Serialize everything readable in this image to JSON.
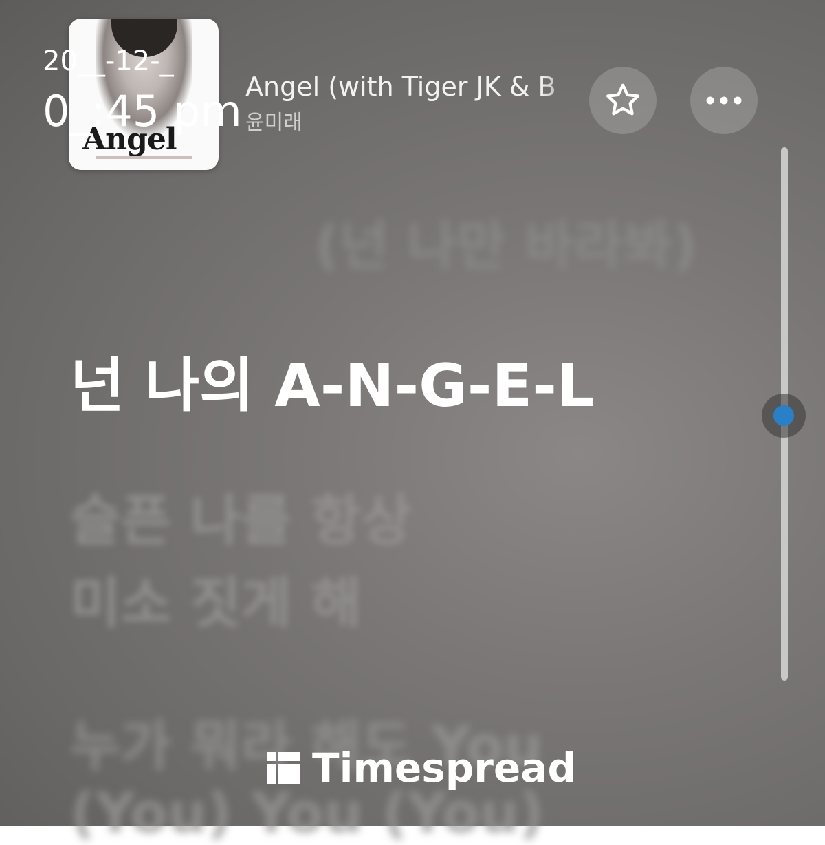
{
  "timestamp": {
    "date": "20__-12-_",
    "time": "0_:45 pm"
  },
  "now_playing": {
    "album_art_text": "Angel",
    "title": "Angel (with Tiger JK & B",
    "artist": "윤미래",
    "favorite_icon": "star-outline-icon",
    "more_icon": "ellipsis-icon"
  },
  "lyrics": {
    "previous": "(넌 나만 바라봐)",
    "current": "넌 나의 A-N-G-E-L",
    "upcoming": [
      "슬픈 나를 항상",
      "미소 짓게 해",
      "누가 뭐라 해도 You",
      "(You) You (You)"
    ]
  },
  "colors": {
    "accent": "#2a7fc6",
    "background": "#7a7776",
    "current_lyric": "#ffffff"
  },
  "watermark": {
    "icon": "timespread-logo-icon",
    "text": "Timespread"
  }
}
